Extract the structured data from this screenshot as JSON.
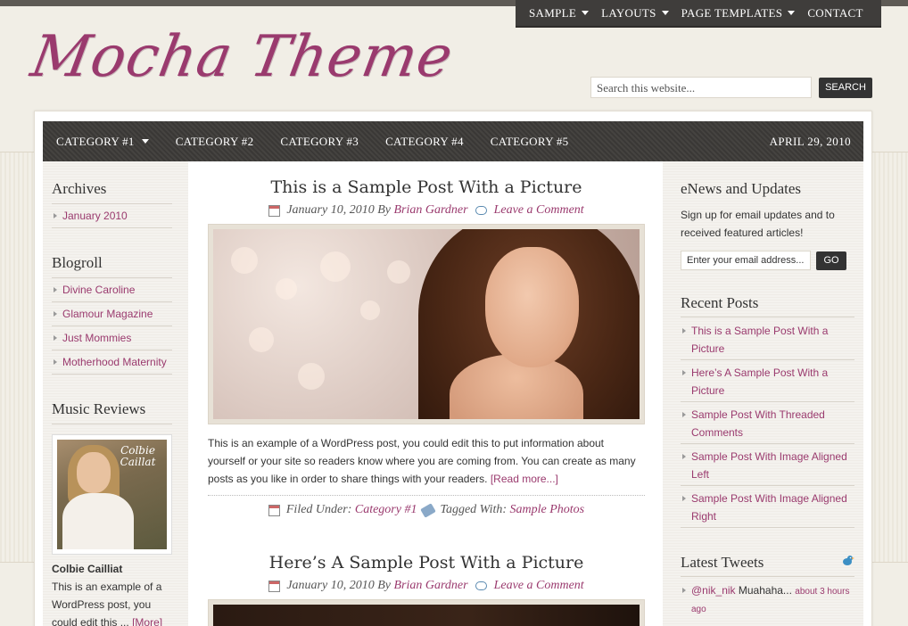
{
  "top_nav": [
    {
      "label": "SAMPLE",
      "has_dropdown": true
    },
    {
      "label": "LAYOUTS",
      "has_dropdown": true
    },
    {
      "label": "PAGE TEMPLATES",
      "has_dropdown": true
    },
    {
      "label": "CONTACT",
      "has_dropdown": false
    }
  ],
  "logo": {
    "text": "Mocha Theme"
  },
  "search": {
    "placeholder": "Search this website...",
    "button_label": "SEARCH"
  },
  "category_nav": {
    "items": [
      {
        "label": "CATEGORY #1",
        "has_dropdown": true
      },
      {
        "label": "CATEGORY #2"
      },
      {
        "label": "CATEGORY #3"
      },
      {
        "label": "CATEGORY #4"
      },
      {
        "label": "CATEGORY #5"
      }
    ],
    "date": "APRIL 29, 2010"
  },
  "left_sidebar": {
    "archives": {
      "title": "Archives",
      "links": [
        "January 2010"
      ]
    },
    "blogroll": {
      "title": "Blogroll",
      "links": [
        "Divine Caroline",
        "Glamour Magazine",
        "Just Mommies",
        "Motherhood Maternity"
      ]
    },
    "music_reviews": {
      "title": "Music Reviews",
      "cover_text": "Colbie Caillat",
      "album_title": "Colbie Cailliat",
      "text_lines": [
        "This is an example of a",
        "WordPress post, you",
        "could edit this ..."
      ],
      "more_label": "[More]"
    }
  },
  "posts": [
    {
      "title": "This is a Sample Post With a Picture",
      "date": "January 10, 2010",
      "by": "By",
      "author": "Brian Gardner",
      "comment_link": "Leave a Comment",
      "excerpt_lines": [
        "This is an example of a WordPress post, you could edit this to put information about",
        "yourself or your site so readers know where you are coming from. You can create as many",
        "posts as you like in order to share things with your readers."
      ],
      "read_more": "[Read more...]",
      "filed_under_label": "Filed Under:",
      "category": "Category #1",
      "tagged_label": "Tagged With:",
      "tag": "Sample Photos"
    },
    {
      "title": "Here’s A Sample Post With a Picture",
      "date": "January 10, 2010",
      "by": "By",
      "author": "Brian Gardner",
      "comment_link": "Leave a Comment"
    }
  ],
  "right_sidebar": {
    "enews": {
      "title": "eNews and Updates",
      "text_lines": [
        "Sign up for email updates and to",
        "received featured articles!"
      ],
      "email_placeholder": "Enter your email address...",
      "go_label": "GO"
    },
    "recent_posts": {
      "title": "Recent Posts",
      "links": [
        [
          "This is a Sample Post With a",
          "Picture"
        ],
        [
          "Here’s A Sample Post With a",
          "Picture"
        ],
        [
          "Sample Post With Threaded",
          "Comments"
        ],
        [
          "Sample Post With Image Aligned",
          "Left"
        ],
        [
          "Sample Post With Image Aligned",
          "Right"
        ]
      ]
    },
    "latest_tweets": {
      "title": "Latest Tweets",
      "handle": "@nik_nik",
      "tweet": "Muahaha...",
      "time_lines": [
        "about 3 hours",
        "ago"
      ]
    }
  },
  "colors": {
    "accent": "#9a3a6e",
    "nav_bg": "#3f3d3b",
    "page_bg": "#efece3"
  }
}
